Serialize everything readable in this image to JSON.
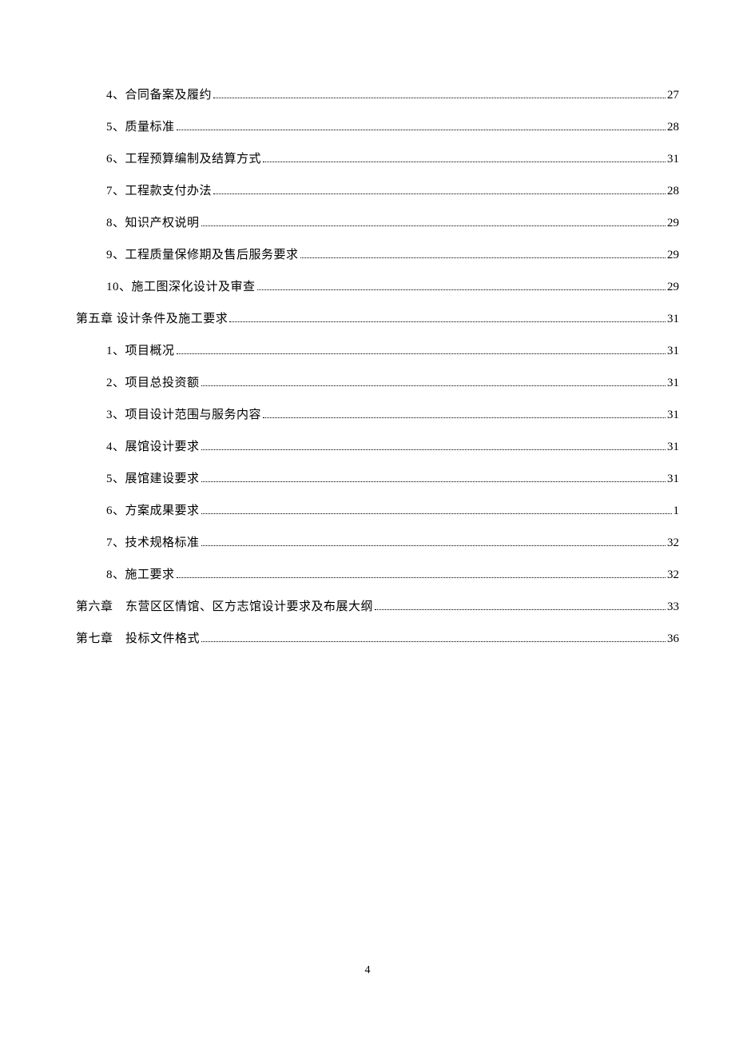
{
  "toc": [
    {
      "level": 2,
      "label": "4、合同备案及履约",
      "page": "27"
    },
    {
      "level": 2,
      "label": "5、质量标准",
      "page": "28"
    },
    {
      "level": 2,
      "label": "6、工程预算编制及结算方式",
      "page": "31"
    },
    {
      "level": 2,
      "label": "7、工程款支付办法",
      "page": "28"
    },
    {
      "level": 2,
      "label": "8、知识产权说明",
      "page": "29"
    },
    {
      "level": 2,
      "label": "9、工程质量保修期及售后服务要求",
      "page": "29"
    },
    {
      "level": 2,
      "label": "10、施工图深化设计及审查",
      "page": "29"
    },
    {
      "level": 1,
      "label": "第五章  设计条件及施工要求",
      "page": "31"
    },
    {
      "level": 2,
      "label": "1、项目概况",
      "page": "31"
    },
    {
      "level": 2,
      "label": "2、项目总投资额",
      "page": "31"
    },
    {
      "level": 2,
      "label": "3、项目设计范围与服务内容",
      "page": "31"
    },
    {
      "level": 2,
      "label": "4、展馆设计要求",
      "page": "31"
    },
    {
      "level": 2,
      "label": "5、展馆建设要求",
      "page": "31"
    },
    {
      "level": 2,
      "label": "6、方案成果要求",
      "page": "1"
    },
    {
      "level": 2,
      "label": "7、技术规格标准",
      "page": "32"
    },
    {
      "level": 2,
      "label": "8、施工要求",
      "page": "32"
    },
    {
      "level": 1,
      "label": "第六章 东营区区情馆、区方志馆设计要求及布展大纲",
      "page": "33"
    },
    {
      "level": 1,
      "label": "第七章 投标文件格式",
      "page": "36"
    }
  ],
  "footer": {
    "page_number": "4"
  }
}
